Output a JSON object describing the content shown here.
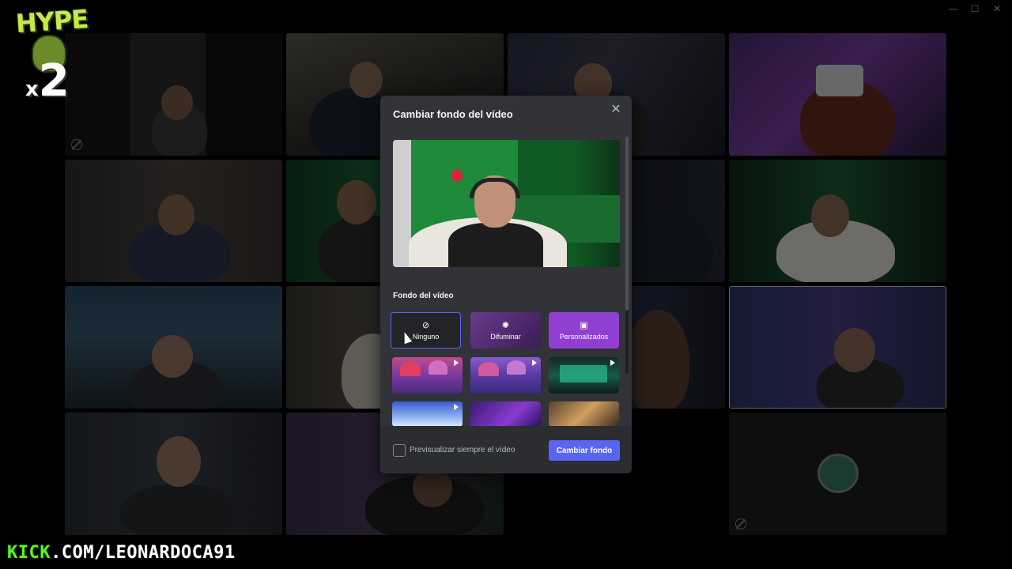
{
  "window": {
    "minimize_icon": "minimize-icon",
    "maximize_icon": "maximize-icon",
    "close_icon": "close-icon",
    "minimize": "—",
    "maximize": "☐",
    "close": "✕"
  },
  "overlay": {
    "hype_word": "HYPE",
    "hype_x": "x",
    "hype_multiplier": "2",
    "kick_prefix": "KICK",
    "kick_rest": ".COM/LEONARDOCA91"
  },
  "modal": {
    "title": "Cambiar fondo del vídeo",
    "close_glyph": "✕",
    "section_label": "Fondo del vídeo",
    "options": [
      {
        "label": "Ninguno",
        "icon": "⊘",
        "icon_name": "no-background-icon",
        "selected": true
      },
      {
        "label": "Difuminar",
        "icon": "✺",
        "icon_name": "blur-icon",
        "selected": false
      },
      {
        "label": "Personalizados",
        "icon": "▣",
        "icon_name": "custom-image-icon",
        "selected": false
      }
    ],
    "backgrounds": [
      {
        "name": "mushroom-room",
        "animated": true
      },
      {
        "name": "mushroom-room-2",
        "animated": true
      },
      {
        "name": "green-arcade",
        "animated": true
      },
      {
        "name": "blue-snow",
        "animated": true
      },
      {
        "name": "purple-space",
        "animated": false
      },
      {
        "name": "golden-lights",
        "animated": false
      }
    ],
    "always_preview_label": "Previsualizar siempre el vídeo",
    "always_preview_checked": false,
    "primary_button": "Cambiar fondo"
  },
  "colors": {
    "modal_bg": "#313338",
    "footer_bg": "#2b2d31",
    "accent": "#5865f2",
    "custom_option": "#8f3fd1",
    "kick_green": "#53fc18",
    "hype_green": "#c6e94a"
  }
}
